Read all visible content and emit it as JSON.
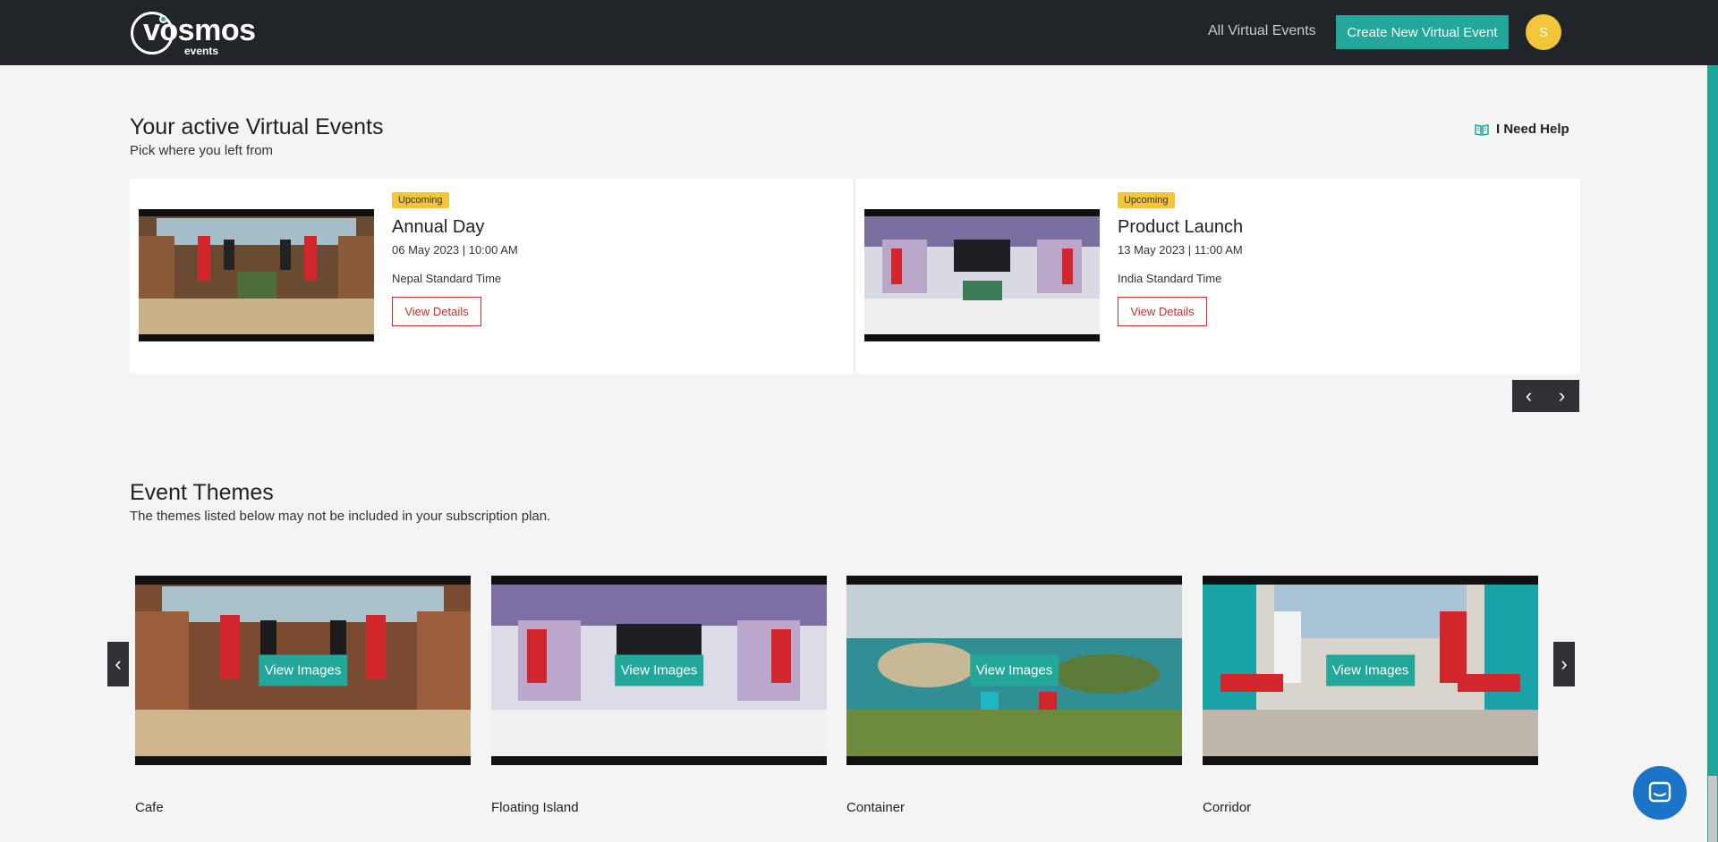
{
  "header": {
    "logo_text": "vosmos",
    "logo_sub": "events",
    "nav_link": "All Virtual Events",
    "create_label": "Create New Virtual Event",
    "avatar_initial": "S"
  },
  "active": {
    "title": "Your active Virtual Events",
    "subtitle": "Pick where you left from",
    "help_label": "I Need Help",
    "events": [
      {
        "badge": "Upcoming",
        "title": "Annual Day",
        "datetime": "06 May 2023 | 10:00 AM",
        "timezone": "Nepal Standard Time",
        "button": "View Details"
      },
      {
        "badge": "Upcoming",
        "title": "Product Launch",
        "datetime": "13 May 2023 | 11:00 AM",
        "timezone": "India Standard Time",
        "button": "View Details"
      }
    ]
  },
  "themes": {
    "title": "Event Themes",
    "subtitle": "The themes listed below may not be included in your subscription plan.",
    "items": [
      {
        "name": "Cafe",
        "button": "View Images"
      },
      {
        "name": "Floating Island",
        "button": "View Images"
      },
      {
        "name": "Container",
        "button": "View Images"
      },
      {
        "name": "Corridor",
        "button": "View Images"
      }
    ]
  },
  "colors": {
    "header_bg": "#212429",
    "accent": "#22a79a",
    "badge": "#f3c53b",
    "danger": "#c9302c",
    "chat": "#1b74c5"
  }
}
